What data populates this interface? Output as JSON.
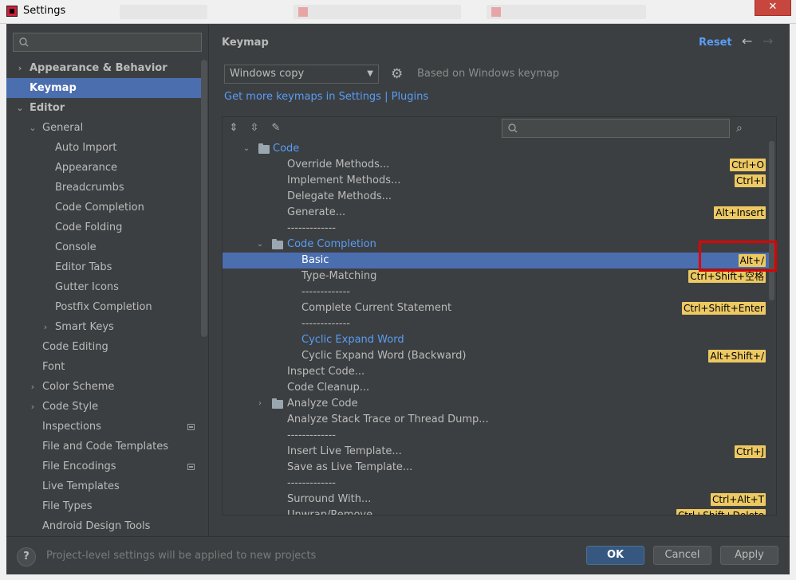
{
  "window": {
    "title": "Settings",
    "close_glyph": "✕"
  },
  "sidebar": {
    "items": [
      {
        "label": "Appearance & Behavior",
        "level": 0,
        "arrow": "›",
        "bold": true
      },
      {
        "label": "Keymap",
        "level": 0,
        "arrow": "",
        "bold": true,
        "selected": true
      },
      {
        "label": "Editor",
        "level": 0,
        "arrow": "⌄",
        "bold": true
      },
      {
        "label": "General",
        "level": 1,
        "arrow": "⌄"
      },
      {
        "label": "Auto Import",
        "level": 2,
        "arrow": ""
      },
      {
        "label": "Appearance",
        "level": 2,
        "arrow": ""
      },
      {
        "label": "Breadcrumbs",
        "level": 2,
        "arrow": ""
      },
      {
        "label": "Code Completion",
        "level": 2,
        "arrow": ""
      },
      {
        "label": "Code Folding",
        "level": 2,
        "arrow": ""
      },
      {
        "label": "Console",
        "level": 2,
        "arrow": ""
      },
      {
        "label": "Editor Tabs",
        "level": 2,
        "arrow": ""
      },
      {
        "label": "Gutter Icons",
        "level": 2,
        "arrow": ""
      },
      {
        "label": "Postfix Completion",
        "level": 2,
        "arrow": ""
      },
      {
        "label": "Smart Keys",
        "level": 2,
        "arrow": "›"
      },
      {
        "label": "Code Editing",
        "level": 1,
        "arrow": ""
      },
      {
        "label": "Font",
        "level": 1,
        "arrow": ""
      },
      {
        "label": "Color Scheme",
        "level": 1,
        "arrow": "›"
      },
      {
        "label": "Code Style",
        "level": 1,
        "arrow": "›"
      },
      {
        "label": "Inspections",
        "level": 1,
        "arrow": "",
        "badge": true
      },
      {
        "label": "File and Code Templates",
        "level": 1,
        "arrow": ""
      },
      {
        "label": "File Encodings",
        "level": 1,
        "arrow": "",
        "badge": true
      },
      {
        "label": "Live Templates",
        "level": 1,
        "arrow": ""
      },
      {
        "label": "File Types",
        "level": 1,
        "arrow": ""
      },
      {
        "label": "Android Design Tools",
        "level": 1,
        "arrow": ""
      }
    ]
  },
  "main": {
    "title": "Keymap",
    "reset_label": "Reset",
    "back_glyph": "←",
    "forward_glyph": "→",
    "keymap_value": "Windows copy",
    "based_on": "Based on Windows keymap",
    "more_link": "Get more keymaps in Settings | Plugins"
  },
  "toolbar": {
    "expand_glyph": "⇕",
    "collapse_glyph": "⇳",
    "edit_glyph": "✎",
    "find_glyph": "⌕"
  },
  "keymap_rows": [
    {
      "label": "Code",
      "indent": 0,
      "arrow": "⌄",
      "folder": true,
      "link": true
    },
    {
      "label": "Override Methods...",
      "indent": 1,
      "shortcut": "Ctrl+O"
    },
    {
      "label": "Implement Methods...",
      "indent": 1,
      "shortcut": "Ctrl+I"
    },
    {
      "label": "Delegate Methods...",
      "indent": 1
    },
    {
      "label": "Generate...",
      "indent": 1,
      "shortcut": "Alt+Insert"
    },
    {
      "label": "-------------",
      "indent": 1
    },
    {
      "label": "Code Completion",
      "indent": 1,
      "arrow": "⌄",
      "folder": true,
      "link": true
    },
    {
      "label": "Basic",
      "indent": 2,
      "shortcut": "Alt+/",
      "selected": true
    },
    {
      "label": "Type-Matching",
      "indent": 2,
      "shortcut": "Ctrl+Shift+空格"
    },
    {
      "label": "-------------",
      "indent": 2
    },
    {
      "label": "Complete Current Statement",
      "indent": 2,
      "shortcut": "Ctrl+Shift+Enter"
    },
    {
      "label": "-------------",
      "indent": 2
    },
    {
      "label": "Cyclic Expand Word",
      "indent": 2,
      "link": true
    },
    {
      "label": "Cyclic Expand Word (Backward)",
      "indent": 2,
      "shortcut": "Alt+Shift+/"
    },
    {
      "label": "Inspect Code...",
      "indent": 1
    },
    {
      "label": "Code Cleanup...",
      "indent": 1
    },
    {
      "label": "Analyze Code",
      "indent": 1,
      "arrow": "›",
      "folder": true
    },
    {
      "label": "Analyze Stack Trace or Thread Dump...",
      "indent": 1
    },
    {
      "label": "-------------",
      "indent": 1
    },
    {
      "label": "Insert Live Template...",
      "indent": 1,
      "shortcut": "Ctrl+J"
    },
    {
      "label": "Save as Live Template...",
      "indent": 1
    },
    {
      "label": "-------------",
      "indent": 1
    },
    {
      "label": "Surround With...",
      "indent": 1,
      "shortcut": "Ctrl+Alt+T"
    },
    {
      "label": "Unwrap/Remove...",
      "indent": 1,
      "shortcut": "Ctrl+Shift+Delete"
    }
  ],
  "footer": {
    "help_glyph": "?",
    "note": "Project-level settings will be applied to new projects",
    "ok": "OK",
    "cancel": "Cancel",
    "apply": "Apply"
  }
}
